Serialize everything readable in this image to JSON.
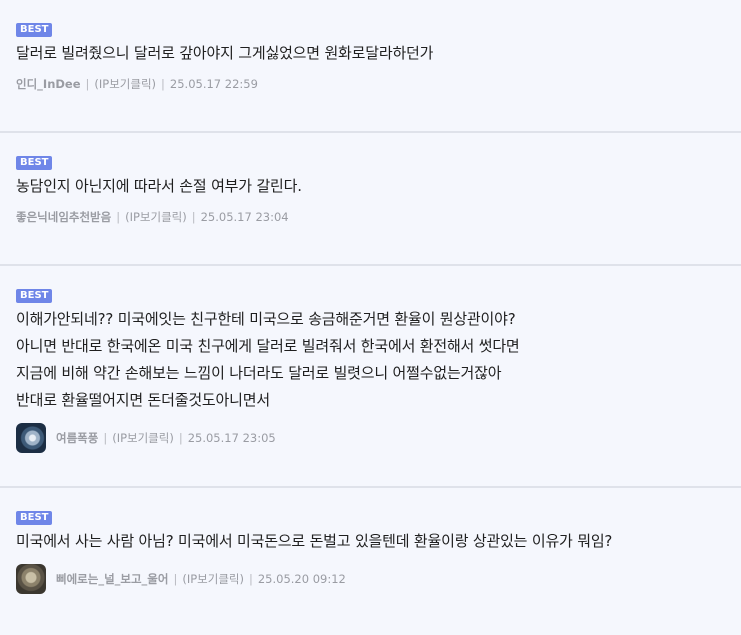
{
  "badge_label": "BEST",
  "ip_label": "(IP보기클릭)",
  "comments": [
    {
      "text": "달러로 빌려줬으니 달러로 갚아야지 그게싫었으면 원화로달라하던가",
      "nickname": "인디_InDee",
      "date": "25.05.17 22:59",
      "avatar": null
    },
    {
      "text": "농담인지 아닌지에 따라서 손절 여부가 갈린다.",
      "nickname": "좋은닉네임추천받음",
      "date": "25.05.17 23:04",
      "avatar": null
    },
    {
      "text": "이해가안되네?? 미국에잇는 친구한테 미국으로 송금해준거면 환율이 뭔상관이야?\n아니면 반대로 한국에온 미국 친구에게 달러로 빌려줘서 한국에서 환전해서 썻다면\n지금에 비해 약간 손해보는 느낌이 나더라도 달러로 빌렷으니 어쩔수없는거잖아\n반대로 환율떨어지면 돈더줄것도아니면서",
      "nickname": "여름폭풍",
      "date": "25.05.17 23:05",
      "avatar": "storm-avatar-icon"
    },
    {
      "text": "미국에서 사는 사람 아님? 미국에서 미국돈으로 돈벌고 있을텐데 환율이랑 상관있는 이유가 뭐임?",
      "nickname": "삐에로는_널_보고_울어",
      "date": "25.05.20 09:12",
      "avatar": "pierrot-avatar-icon"
    }
  ]
}
